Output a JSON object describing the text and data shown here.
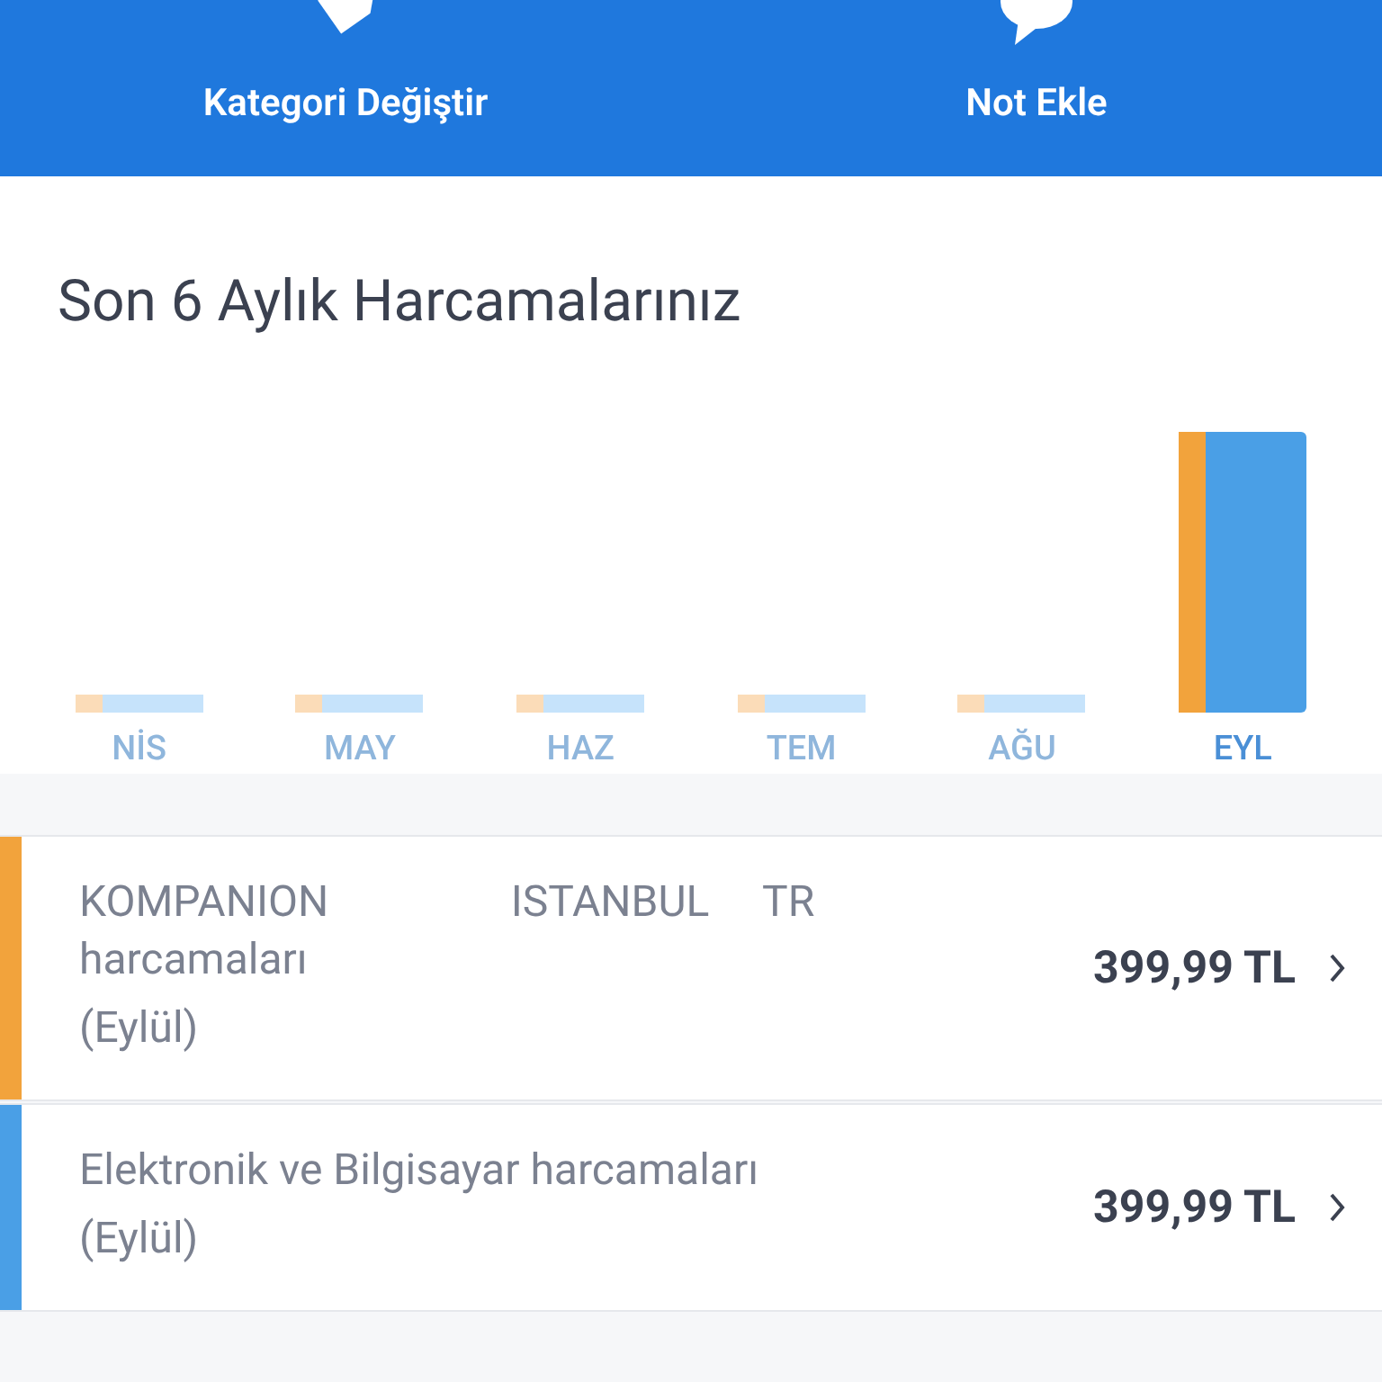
{
  "actions": [
    {
      "kind": "tag",
      "label": "Kategori Değiştir"
    },
    {
      "kind": "note",
      "label": "Not Ekle"
    }
  ],
  "chart": {
    "title": "Son 6 Aylık Harcamalarınız",
    "months": [
      {
        "label": "NİS",
        "selected": false
      },
      {
        "label": "MAY",
        "selected": false
      },
      {
        "label": "HAZ",
        "selected": false
      },
      {
        "label": "TEM",
        "selected": false
      },
      {
        "label": "AĞU",
        "selected": false
      },
      {
        "label": "EYL",
        "selected": true
      }
    ]
  },
  "expenses": [
    {
      "title": "KOMPANION                 ISTANBUL     TR harcamaları",
      "period": "(Eylül)",
      "amount": "399,99 TL",
      "color": "#f2a33c"
    },
    {
      "title": "Elektronik ve Bilgisayar harcamaları",
      "period": "(Eylül)",
      "amount": "399,99 TL",
      "color": "#4a9fe6"
    }
  ]
}
